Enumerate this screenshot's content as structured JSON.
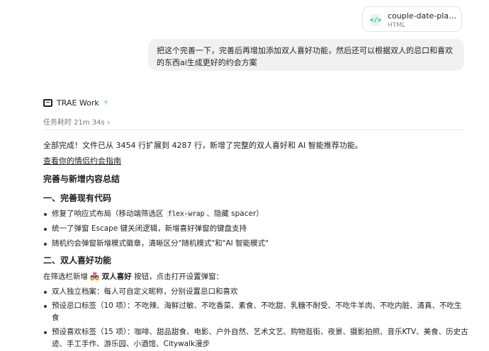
{
  "attachment": {
    "file_name": "couple-date-planner...",
    "file_type": "HTML",
    "icon": "code-file-icon"
  },
  "user_message": "把这个完善一下，完善后再增加添加双人喜好功能，然后还可以根据双人的忌口和喜欢的东西ai生成更好的约会方案",
  "agent": {
    "name": "TRAE Work",
    "task_time": "任务耗时 21m 34s",
    "chevron": "›"
  },
  "response": {
    "intro": "全部完成！文件已从 3454 行扩展到 4287 行，新增了完整的双人喜好和 AI 智能推荐功能。",
    "link": "查看你的情侣约会指南",
    "summary_title": "完善与新增内容总结",
    "section1_title": "一、完善现有代码",
    "section1_items": {
      "item1_pre": "修复了响应式布局（移动端筛选区 ",
      "item1_code": "flex-wrap",
      "item1_post": "、隐藏 spacer）",
      "item2": "统一了弹窗 Escape 键关闭逻辑，新增喜好弹窗的键盘支持",
      "item3": "随机约会弹窗新增模式徽章，清晰区分\"随机模式\"和\"AI 智能模式\""
    },
    "section2_title": "二、双人喜好功能",
    "section2_intro_pre": "在筛选栏新增 ",
    "section2_intro_emoji": "💑",
    "section2_intro_bold": "双人喜好",
    "section2_intro_post": " 按钮，点击打开设置弹窗：",
    "section2_items": {
      "item1": "双人独立档案：每人可自定义昵称，分别设置忌口和喜欢",
      "item2": "预设忌口标签（10 项）：不吃辣、海鲜过敏、不吃香菜、素食、不吃甜、乳糖不耐受、不吃牛羊肉、不吃内脏、清真、不吃生食",
      "item3": "预设喜欢标签（15 项）：咖啡、甜品甜食、电影、户外自然、艺术文艺、购物逛街、夜景、摄影拍照、音乐KTV、美食、历史古迹、手工手作、游乐园、小酒馆、Citywalk漫步"
    }
  }
}
